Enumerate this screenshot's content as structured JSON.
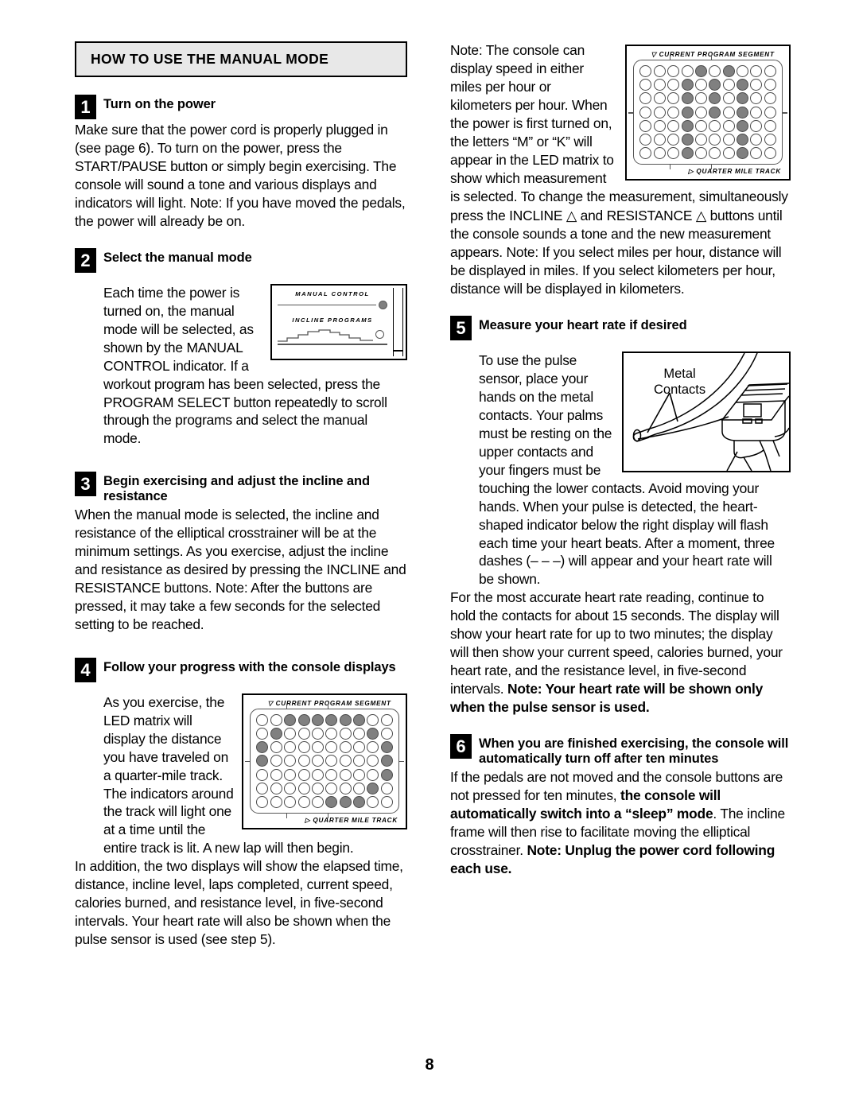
{
  "page": {
    "banner_title": "HOW TO USE THE MANUAL MODE",
    "folio": "8"
  },
  "steps": [
    {
      "number": "1",
      "title": "Turn on the power",
      "body": "Make sure that the power cord is properly plugged in (see page 6). To turn on the power, press the START/PAUSE button or simply begin exercising. The console will sound a tone and various displays and indicators will light. Note: If you have moved the pedals, the power will already be on."
    },
    {
      "number": "2",
      "title": "Select the manual mode",
      "body_a": "Each time the power is turned on, the manual mode will be selected, as shown by the MANUAL CONTROL indicator. If a workout program has been selected, press the PROGRAM SELECT button repeatedly to scroll through the programs and select the manual mode."
    },
    {
      "number": "3",
      "title": "Begin exercising and adjust the incline and resistance",
      "body": "When the manual mode is selected, the incline and resistance of the elliptical crosstrainer will be at the minimum settings. As you exercise, adjust the incline and resistance as desired by pressing the INCLINE and RESISTANCE buttons. Note: After the buttons are pressed, it may take a few seconds for the selected setting to be reached."
    },
    {
      "number": "4",
      "title": "Follow your progress with the console displays",
      "body_a": "As you exercise, the LED matrix will display the distance you have traveled on a quarter-mile track. The indicators around the track will light one at a time until the entire track is lit. A new lap will then begin.",
      "body_b": "In addition, the two displays will show the elapsed time, distance, incline level, laps completed, current speed, calories burned, and resistance level, in five-second intervals. Your heart rate will also be shown when the pulse sensor is used (see step 5)."
    },
    {
      "number": "5",
      "title": "Measure your heart rate if desired",
      "body_a": "To use the pulse sensor, place your hands on the metal contacts. Your palms must be resting on the upper contacts and your fingers must be touching the lower contacts. Avoid moving your hands. When your pulse is detected, the heart-shaped indicator below the right display will flash each time your heart beats. After a moment, three dashes (– – –) will appear and your heart rate will be shown.",
      "body_b_plain_1": "For the most accurate heart rate reading, continue to hold the contacts for about 15 seconds. The display will show your heart rate for up to two minutes; the display will then show your current speed, calories burned, your heart rate, and the resistance level, in five-second intervals. ",
      "body_b_bold_1": "Note: Your heart rate will be shown only when the pulse sensor is used."
    },
    {
      "number": "6",
      "title": "When you are finished exercising, the console will automatically turn off after ten minutes",
      "body_plain_1": "If the pedals are not moved and the console buttons are not pressed for ten minutes, ",
      "body_bold_1": "the console will automatically switch into a “sleep” mode",
      "body_plain_2": ". The incline frame will then rise to facilitate moving the elliptical crosstrainer. ",
      "body_bold_2": "Note: Unplug the power cord following each use."
    }
  ],
  "right_column_intro": {
    "part_1": "Note: The console can display speed in either miles per hour or kilometers per hour. When the power is first turned on, the letters “M” or “K” will appear in the LED matrix to show which measurement is selected. To change the measurement, simultaneously",
    "part_2": "press the INCLINE △ and RESISTANCE △ buttons until the console sounds a tone and the new measurement appears. Note: If you select miles per hour, distance will be displayed in miles. If you select kilometers per hour, distance will be displayed in kilometers."
  },
  "figures": {
    "matrix_m": {
      "label_top": "CURRENT PROGRAM SEGMENT",
      "label_bottom": "QUARTER MILE TRACK",
      "marker_top": "▽",
      "marker_bottom": "▷",
      "rows": 7,
      "cols": 10,
      "on_cells": [
        [
          0,
          4
        ],
        [
          0,
          6
        ],
        [
          1,
          3
        ],
        [
          1,
          5
        ],
        [
          1,
          7
        ],
        [
          2,
          3
        ],
        [
          2,
          5
        ],
        [
          2,
          7
        ],
        [
          3,
          3
        ],
        [
          3,
          5
        ],
        [
          3,
          7
        ],
        [
          4,
          3
        ],
        [
          4,
          7
        ],
        [
          5,
          3
        ],
        [
          5,
          7
        ],
        [
          6,
          3
        ],
        [
          6,
          7
        ]
      ]
    },
    "matrix_track": {
      "label_top": "CURRENT PROGRAM SEGMENT",
      "label_bottom": "QUARTER MILE TRACK",
      "marker_top": "▽",
      "marker_bottom": "▷",
      "rows": 7,
      "cols": 10,
      "on_cells": [
        [
          0,
          2
        ],
        [
          0,
          3
        ],
        [
          0,
          4
        ],
        [
          0,
          5
        ],
        [
          0,
          6
        ],
        [
          0,
          7
        ],
        [
          1,
          1
        ],
        [
          1,
          8
        ],
        [
          2,
          0
        ],
        [
          2,
          9
        ],
        [
          3,
          0
        ],
        [
          3,
          9
        ],
        [
          4,
          9
        ],
        [
          5,
          8
        ],
        [
          6,
          5
        ],
        [
          6,
          6
        ],
        [
          6,
          7
        ]
      ]
    },
    "manual_control": {
      "line_1": "MANUAL CONTROL",
      "line_2": "INCLINE PROGRAMS",
      "indicator_1_state": "filled",
      "indicator_2_state": "open"
    },
    "contacts": {
      "label_line_1": "Metal",
      "label_line_2": "Contacts"
    }
  },
  "colors": {
    "banner_fill": "#e8e8e8",
    "led_on": "#808080",
    "led_off": "#ffffff",
    "ink": "#000000"
  }
}
